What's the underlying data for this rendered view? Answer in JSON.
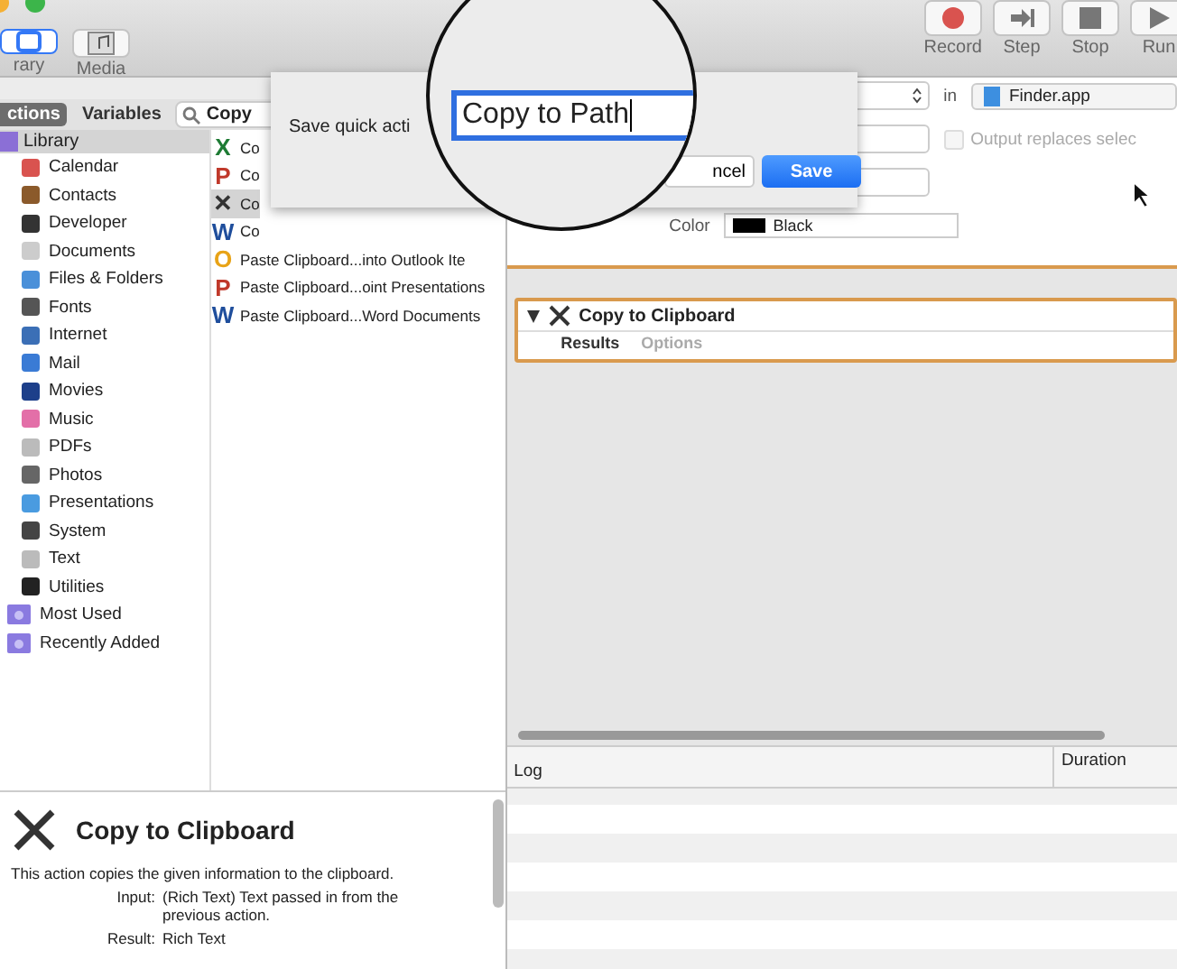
{
  "toolbar": {
    "left_buttons": [
      {
        "label": "rary",
        "selected": true
      },
      {
        "label": "Media",
        "selected": false
      }
    ],
    "right_buttons": [
      {
        "label": "Record",
        "kind": "record"
      },
      {
        "label": "Step",
        "kind": "step"
      },
      {
        "label": "Stop",
        "kind": "stop"
      },
      {
        "label": "Run",
        "kind": "run"
      }
    ]
  },
  "pane_tabs": [
    {
      "label": "ctions",
      "selected": true
    },
    {
      "label": "Variables",
      "selected": false
    }
  ],
  "search": {
    "value": "Copy"
  },
  "library": {
    "label": "Library",
    "selected": true,
    "children": [
      {
        "label": "Calendar",
        "color": "#d9534f"
      },
      {
        "label": "Contacts",
        "color": "#8b5a2b"
      },
      {
        "label": "Developer",
        "color": "#333333"
      },
      {
        "label": "Documents",
        "color": "#cccccc"
      },
      {
        "label": "Files & Folders",
        "color": "#4a90d9"
      },
      {
        "label": "Fonts",
        "color": "#555555"
      },
      {
        "label": "Internet",
        "color": "#3b6fb6"
      },
      {
        "label": "Mail",
        "color": "#3a7bd5"
      },
      {
        "label": "Movies",
        "color": "#1d3f8a"
      },
      {
        "label": "Music",
        "color": "#e36fa8"
      },
      {
        "label": "PDFs",
        "color": "#bbbbbb"
      },
      {
        "label": "Photos",
        "color": "#666666"
      },
      {
        "label": "Presentations",
        "color": "#4a9be0"
      },
      {
        "label": "System",
        "color": "#444444"
      },
      {
        "label": "Text",
        "color": "#bbbbbb"
      },
      {
        "label": "Utilities",
        "color": "#222222"
      }
    ]
  },
  "smart_groups": [
    {
      "label": "Most Used"
    },
    {
      "label": "Recently Added"
    }
  ],
  "actions": [
    {
      "label": "Co",
      "letter": "X",
      "color": "#1e7b34",
      "selected": false
    },
    {
      "label": "Co",
      "letter": "P",
      "color": "#c0392b",
      "selected": false
    },
    {
      "label": "Co",
      "letter": "✕",
      "color": "#333333",
      "selected": true
    },
    {
      "label": "Co",
      "letter": "W",
      "color": "#1f4e9c",
      "selected": false
    },
    {
      "label": "Paste Clipboard...into Outlook Ite",
      "letter": "O",
      "color": "#e8a317",
      "selected": false
    },
    {
      "label": "Paste Clipboard...oint Presentations",
      "letter": "P",
      "color": "#c0392b",
      "selected": false
    },
    {
      "label": "Paste Clipboard...Word Documents",
      "letter": "W",
      "color": "#1f4e9c",
      "selected": false
    }
  ],
  "dialog": {
    "label": "Save quick acti",
    "field_value": "Copy to Path",
    "cancel": "ncel",
    "save": "Save"
  },
  "settings": {
    "in_label": "in",
    "app": "Finder.app",
    "checkbox": {
      "label": "Output replaces selec",
      "checked": false,
      "disabled": true
    },
    "color_label": "Color",
    "color_value": "Black"
  },
  "action_card": {
    "title": "Copy to Clipboard",
    "expanded": true,
    "tabs": [
      {
        "label": "Results",
        "selected": true
      },
      {
        "label": "Options",
        "selected": false
      }
    ]
  },
  "log": {
    "columns": [
      "Log",
      "Duration"
    ]
  },
  "description": {
    "title": "Copy to Clipboard",
    "text": "This action copies the given information to the clipboard.",
    "fields": [
      {
        "key": "Input:",
        "value": "(Rich Text) Text passed in from the previous action."
      },
      {
        "key": "Result:",
        "value": "Rich Text"
      }
    ]
  }
}
